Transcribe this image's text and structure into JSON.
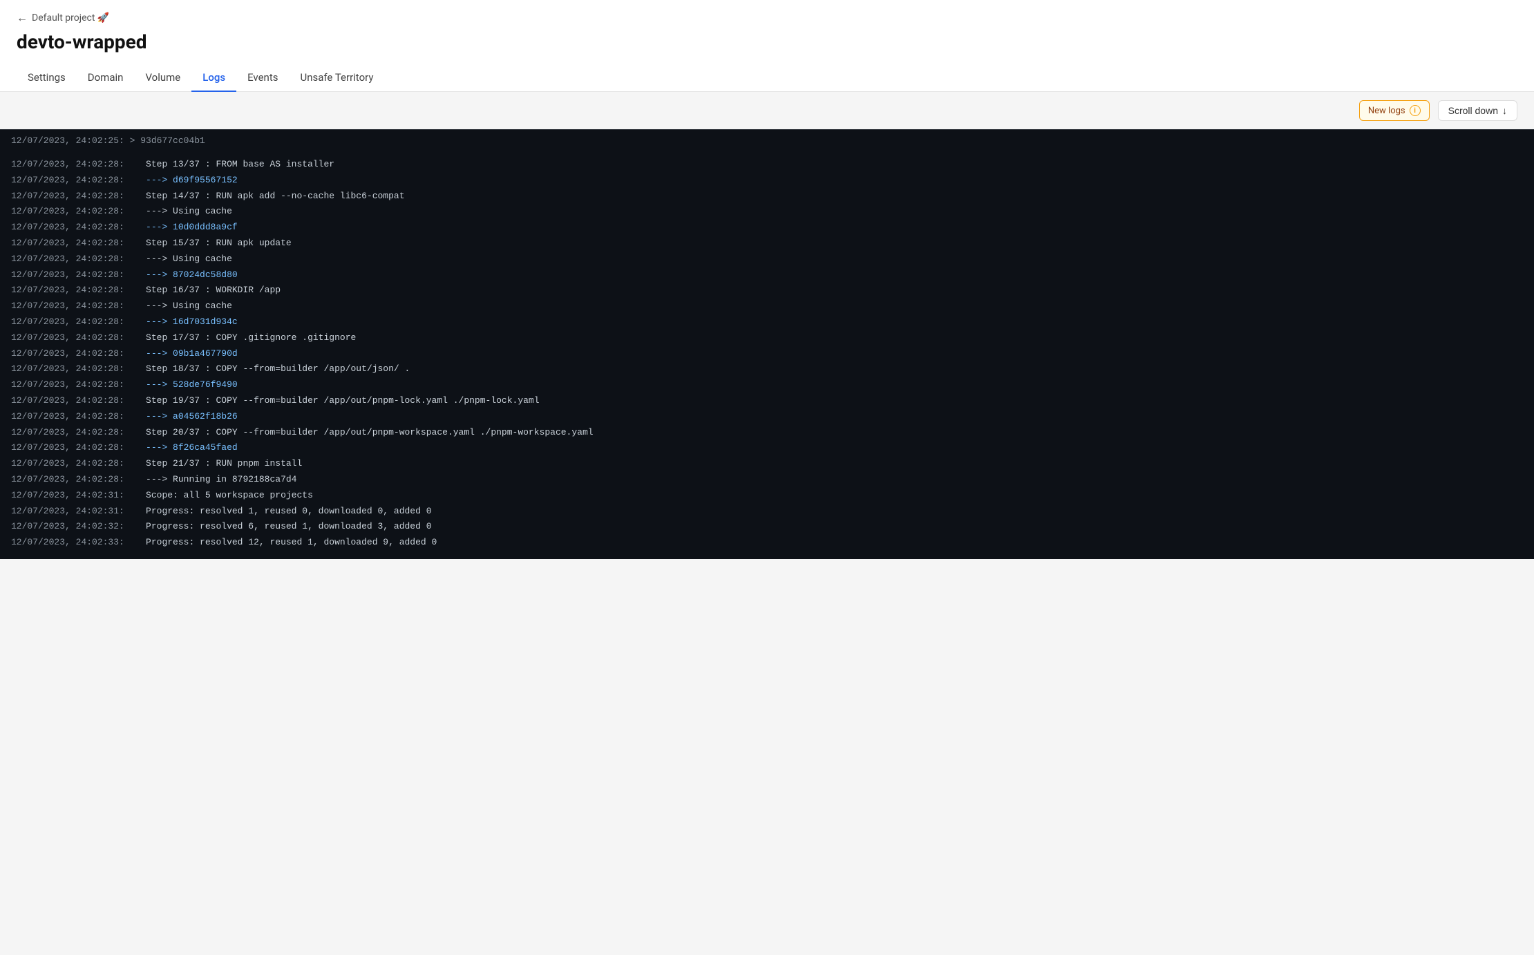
{
  "header": {
    "back_label": "Default project 🚀",
    "title": "devto-wrapped",
    "tabs": [
      {
        "id": "settings",
        "label": "Settings",
        "active": false
      },
      {
        "id": "domain",
        "label": "Domain",
        "active": false
      },
      {
        "id": "volume",
        "label": "Volume",
        "active": false
      },
      {
        "id": "logs",
        "label": "Logs",
        "active": true
      },
      {
        "id": "events",
        "label": "Events",
        "active": false
      },
      {
        "id": "unsafe-territory",
        "label": "Unsafe Territory",
        "active": false
      }
    ]
  },
  "toolbar": {
    "new_logs_label": "New logs",
    "info_icon_label": "ℹ",
    "scroll_down_label": "Scroll down",
    "scroll_down_icon": "↓"
  },
  "logs": {
    "partial_top": "12/07/2023, 24:02:25:    > 93d677cc04b1",
    "lines": [
      {
        "timestamp": "12/07/2023, 24:02:28:",
        "content": "   Step 13/37 : FROM base AS installer"
      },
      {
        "timestamp": "12/07/2023, 24:02:28:",
        "content": "   ---> d69f95567152",
        "is_hash": true
      },
      {
        "timestamp": "12/07/2023, 24:02:28:",
        "content": "   Step 14/37 : RUN apk add --no-cache libc6-compat"
      },
      {
        "timestamp": "12/07/2023, 24:02:28:",
        "content": "   ---> Using cache"
      },
      {
        "timestamp": "12/07/2023, 24:02:28:",
        "content": "   ---> 10d0ddd8a9cf",
        "is_hash": true
      },
      {
        "timestamp": "12/07/2023, 24:02:28:",
        "content": "   Step 15/37 : RUN apk update"
      },
      {
        "timestamp": "12/07/2023, 24:02:28:",
        "content": "   ---> Using cache"
      },
      {
        "timestamp": "12/07/2023, 24:02:28:",
        "content": "   ---> 87024dc58d80",
        "is_hash": true
      },
      {
        "timestamp": "12/07/2023, 24:02:28:",
        "content": "   Step 16/37 : WORKDIR /app"
      },
      {
        "timestamp": "12/07/2023, 24:02:28:",
        "content": "   ---> Using cache"
      },
      {
        "timestamp": "12/07/2023, 24:02:28:",
        "content": "   ---> 16d7031d934c",
        "is_hash": true
      },
      {
        "timestamp": "12/07/2023, 24:02:28:",
        "content": "   Step 17/37 : COPY .gitignore .gitignore"
      },
      {
        "timestamp": "12/07/2023, 24:02:28:",
        "content": "   ---> 09b1a467790d",
        "is_hash": true
      },
      {
        "timestamp": "12/07/2023, 24:02:28:",
        "content": "   Step 18/37 : COPY --from=builder /app/out/json/ ."
      },
      {
        "timestamp": "12/07/2023, 24:02:28:",
        "content": "   ---> 528de76f9490",
        "is_hash": true
      },
      {
        "timestamp": "12/07/2023, 24:02:28:",
        "content": "   Step 19/37 : COPY --from=builder /app/out/pnpm-lock.yaml ./pnpm-lock.yaml"
      },
      {
        "timestamp": "12/07/2023, 24:02:28:",
        "content": "   ---> a04562f18b26",
        "is_hash": true
      },
      {
        "timestamp": "12/07/2023, 24:02:28:",
        "content": "   Step 20/37 : COPY --from=builder /app/out/pnpm-workspace.yaml ./pnpm-workspace.yaml"
      },
      {
        "timestamp": "12/07/2023, 24:02:28:",
        "content": "   ---> 8f26ca45faed",
        "is_hash": true
      },
      {
        "timestamp": "12/07/2023, 24:02:28:",
        "content": "   Step 21/37 : RUN pnpm install"
      },
      {
        "timestamp": "12/07/2023, 24:02:28:",
        "content": "   ---> Running in 8792188ca7d4"
      },
      {
        "timestamp": "12/07/2023, 24:02:31:",
        "content": "   Scope: all 5 workspace projects"
      },
      {
        "timestamp": "12/07/2023, 24:02:31:",
        "content": "   Progress: resolved 1, reused 0, downloaded 0, added 0"
      },
      {
        "timestamp": "12/07/2023, 24:02:32:",
        "content": "   Progress: resolved 6, reused 1, downloaded 3, added 0"
      },
      {
        "timestamp": "12/07/2023, 24:02:33:",
        "content": "   Progress: resolved 12, reused 1, downloaded 9, added 0"
      }
    ]
  }
}
